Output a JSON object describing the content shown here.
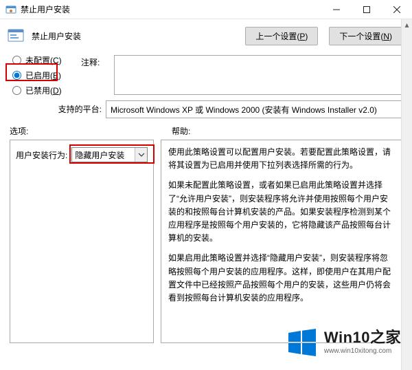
{
  "window": {
    "title": "禁止用户安装"
  },
  "header": {
    "title": "禁止用户安装",
    "prev_label": "上一个设置(P)",
    "next_label": "下一个设置(N)"
  },
  "states": {
    "not_configured": "未配置(C)",
    "enabled": "已启用(E)",
    "disabled": "已禁用(D)",
    "selected": "enabled"
  },
  "meta": {
    "comment_label": "注释:",
    "comment_value": "",
    "platform_label": "支持的平台:",
    "platform_value": "Microsoft Windows XP 或 Windows 2000 (安装有 Windows Installer v2.0)"
  },
  "optionsHelp": {
    "options_header": "选项:",
    "help_header": "帮助:"
  },
  "options": {
    "behavior_label": "用户安装行为:",
    "behavior_value": "隐藏用户安装"
  },
  "help": {
    "p1": "使用此策略设置可以配置用户安装。若要配置此策略设置，请将其设置为已启用并使用下拉列表选择所需的行为。",
    "p2": "如果未配置此策略设置，或者如果已启用此策略设置并选择了“允许用户安装”，则安装程序将允许并使用按照每个用户安装的和按照每台计算机安装的产品。如果安装程序检测到某个应用程序是按照每个用户安装的，它将隐藏该产品按照每台计算机的安装。",
    "p3": "如果启用此策略设置并选择“隐藏用户安装”，则安装程序将忽略按照每个用户安装的应用程序。这样，即使用户在其用户配置文件中已经按照产品按照每个用户的安装，这些用户仍将会看到按照每台计算机安装的应用程序。"
  },
  "watermark": {
    "brand": "Win10之家",
    "url": "www.win10xitong.com"
  }
}
